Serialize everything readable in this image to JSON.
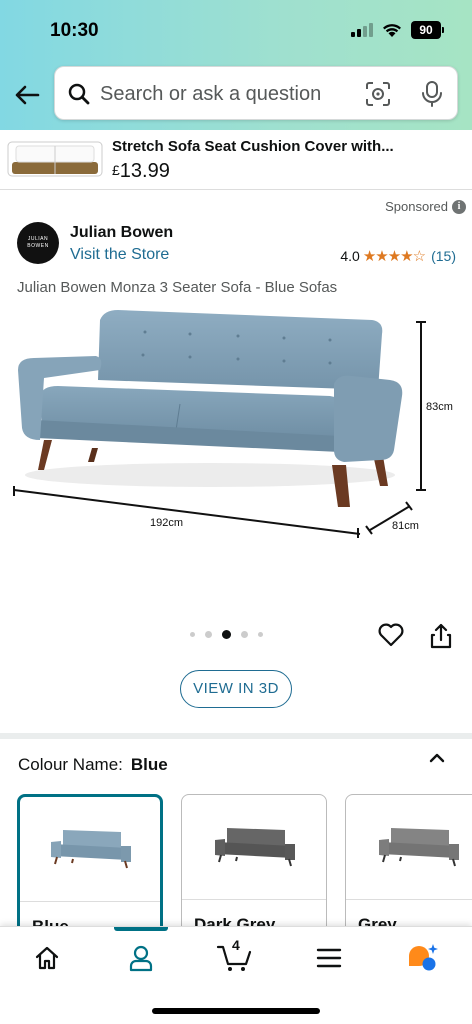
{
  "status_bar": {
    "time": "10:30",
    "battery": "90"
  },
  "search": {
    "placeholder": "Search or ask a question"
  },
  "sponsored_product": {
    "title": "Stretch Sofa Seat Cushion Cover with...",
    "currency": "£",
    "price": "13.99"
  },
  "sponsored_label": "Sponsored",
  "brand": {
    "logo_line1": "JULIAN",
    "logo_line2": "BOWEN",
    "name": "Julian Bowen",
    "visit_store": "Visit the Store"
  },
  "rating": {
    "value": "4.0",
    "stars_text": "★★★★☆",
    "count": "(15)"
  },
  "product": {
    "title": "Julian Bowen Monza 3 Seater Sofa - Blue Sofas",
    "dimensions": {
      "width": "192cm",
      "depth": "81cm",
      "height": "83cm"
    },
    "image_index": 3,
    "image_count": 5
  },
  "view_3d_label": "VIEW IN 3D",
  "colour": {
    "label": "Colour Name:",
    "selected": "Blue",
    "options": [
      {
        "name": "Blue",
        "color": "#7f9fb5"
      },
      {
        "name": "Dark Grey",
        "color": "#5b5b5b"
      },
      {
        "name": "Grey",
        "color": "#7c7c7c"
      }
    ]
  },
  "tabbar": {
    "cart_count": "4",
    "active_tab": "account"
  },
  "colors": {
    "link": "#1f6c92",
    "accent": "#007185",
    "star": "#de7921",
    "sofa_blue": "#7f9fb5"
  }
}
